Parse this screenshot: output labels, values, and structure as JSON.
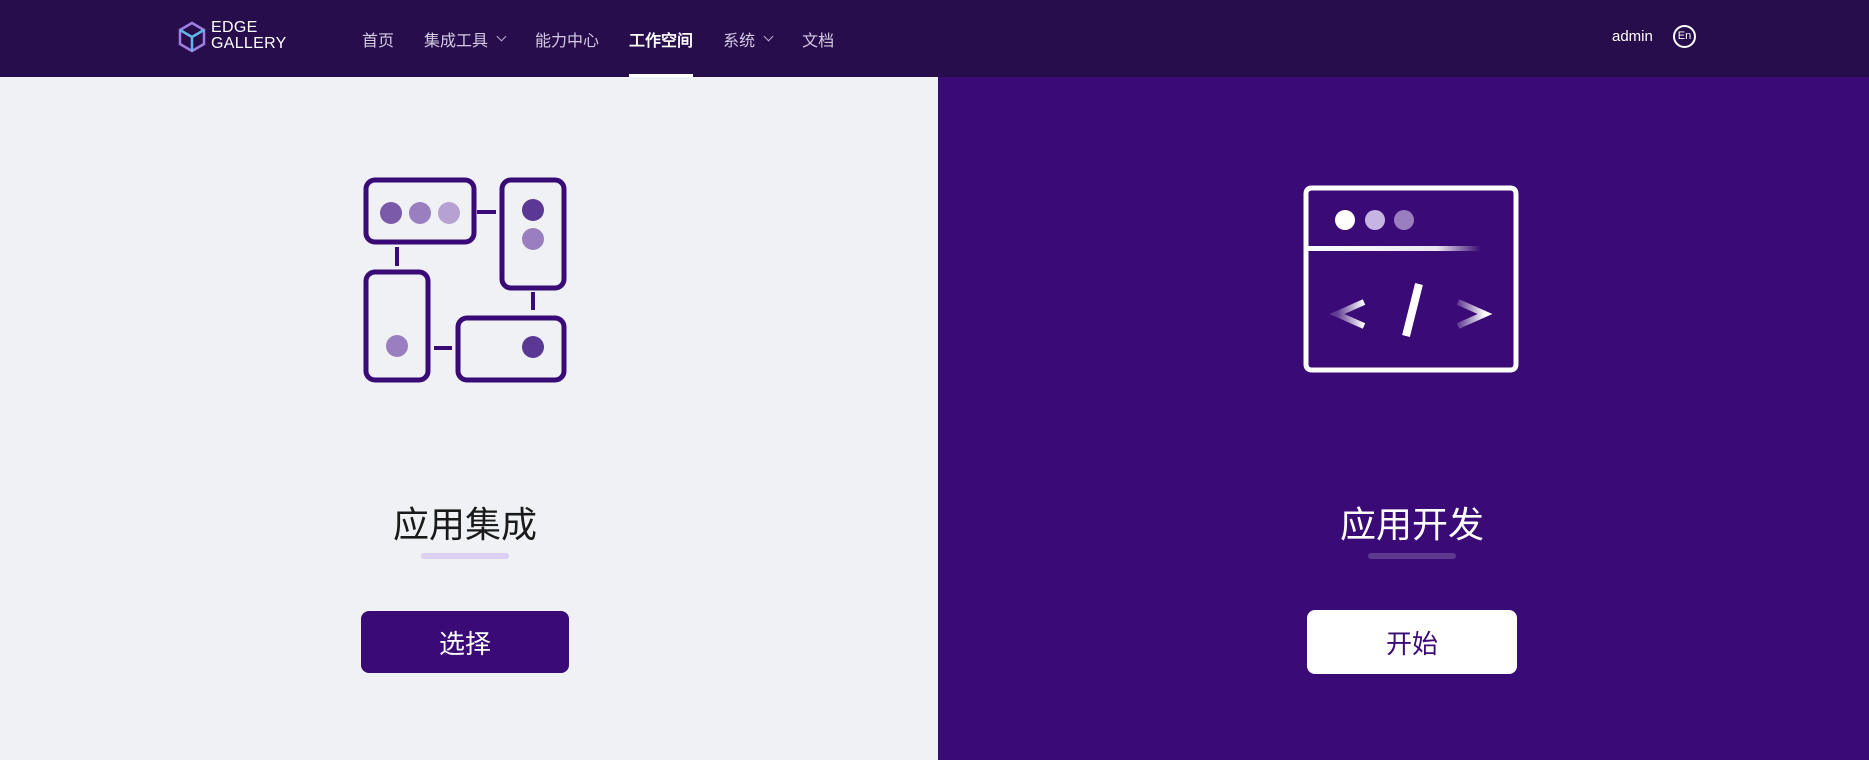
{
  "brand": {
    "line1": "EDGE",
    "line2": "GALLERY"
  },
  "nav": {
    "items": [
      {
        "label": "首页"
      },
      {
        "label": "集成工具"
      },
      {
        "label": "能力中心"
      },
      {
        "label": "工作空间"
      },
      {
        "label": "系统"
      },
      {
        "label": "文档"
      }
    ],
    "active": "工作空间"
  },
  "header": {
    "user": "admin",
    "language": "En"
  },
  "integration": {
    "title": "应用集成",
    "button": "选择",
    "icon": "app-integration-icon"
  },
  "development": {
    "title": "应用开发",
    "button": "开始",
    "icon": "code-window-icon",
    "code_symbol": "< / >"
  },
  "colors": {
    "topbar": "#280d4c",
    "accent": "#3a0a76",
    "light_panel": "#f0f1f5"
  }
}
